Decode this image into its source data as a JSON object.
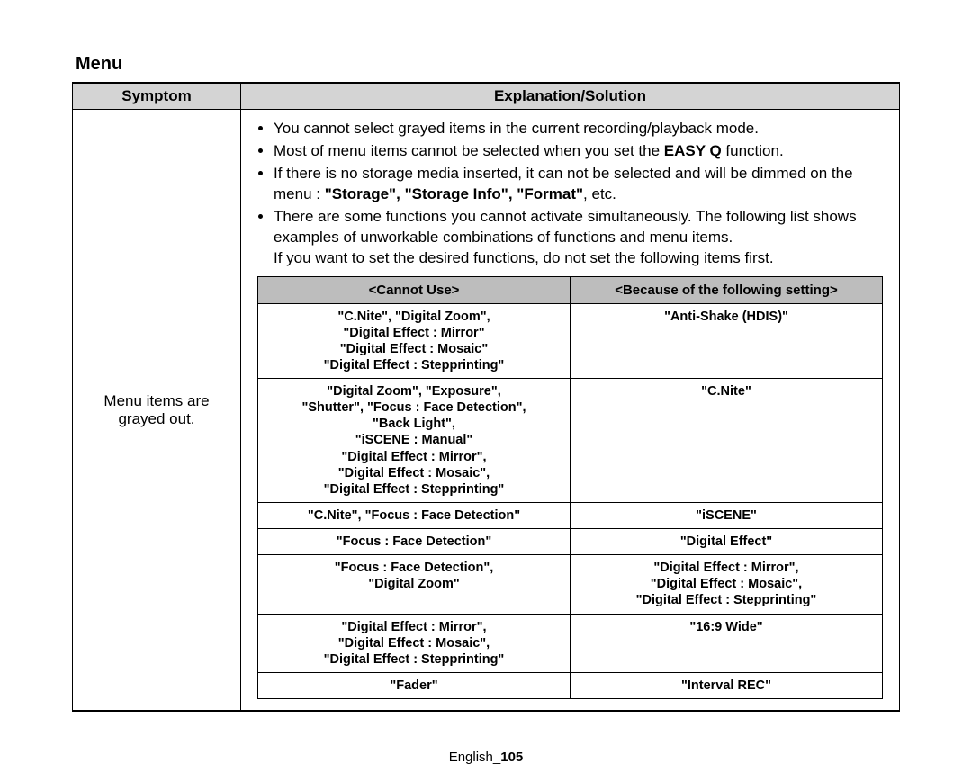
{
  "title": "Menu",
  "headers": {
    "symptom": "Symptom",
    "explanation": "Explanation/Solution"
  },
  "symptom": "Menu items are grayed out.",
  "bullets": {
    "b1": "You cannot select grayed items in the current recording/playback mode.",
    "b2a": "Most of menu items cannot be selected when you set the ",
    "b2b": "EASY Q",
    "b2c": " function.",
    "b3a": "If there is no storage media inserted, it can not be selected and will be dimmed on the menu : ",
    "b3b": "\"Storage\", \"Storage Info\", \"Format\"",
    "b3c": ", etc.",
    "b4": "There are some functions you cannot activate simultaneously. The following list shows examples of unworkable combinations of functions and menu items.",
    "b4_line2": "If you want to set the desired functions, do not set the following items first."
  },
  "inner_headers": {
    "left": "<Cannot Use>",
    "right": "<Because of the following setting>"
  },
  "rows": [
    {
      "l": "\"C.Nite\", \"Digital Zoom\",\n\"Digital Effect : Mirror\"\n\"Digital Effect : Mosaic\"\n\"Digital Effect : Stepprinting\"",
      "r": "\"Anti-Shake (HDIS)\""
    },
    {
      "l": "\"Digital Zoom\", \"Exposure\",\n\"Shutter\", \"Focus : Face Detection\",\n\"Back Light\",\n\"iSCENE : Manual\"\n\"Digital Effect : Mirror\",\n\"Digital Effect : Mosaic\",\n\"Digital Effect : Stepprinting\"",
      "r": "\"C.Nite\""
    },
    {
      "l": "\"C.Nite\", \"Focus : Face Detection\"",
      "r": "\"iSCENE\""
    },
    {
      "l": "\"Focus : Face Detection\"",
      "r": "\"Digital Effect\""
    },
    {
      "l": "\"Focus : Face Detection\",\n\"Digital Zoom\"",
      "r": "\"Digital Effect : Mirror\",\n\"Digital Effect : Mosaic\",\n\"Digital Effect : Stepprinting\""
    },
    {
      "l": "\"Digital Effect : Mirror\",\n\"Digital Effect : Mosaic\",\n\"Digital Effect : Stepprinting\"",
      "r": "\"16:9 Wide\""
    },
    {
      "l": "\"Fader\"",
      "r": "\"Interval REC\""
    }
  ],
  "footer": {
    "lang": "English_",
    "page": "105"
  }
}
